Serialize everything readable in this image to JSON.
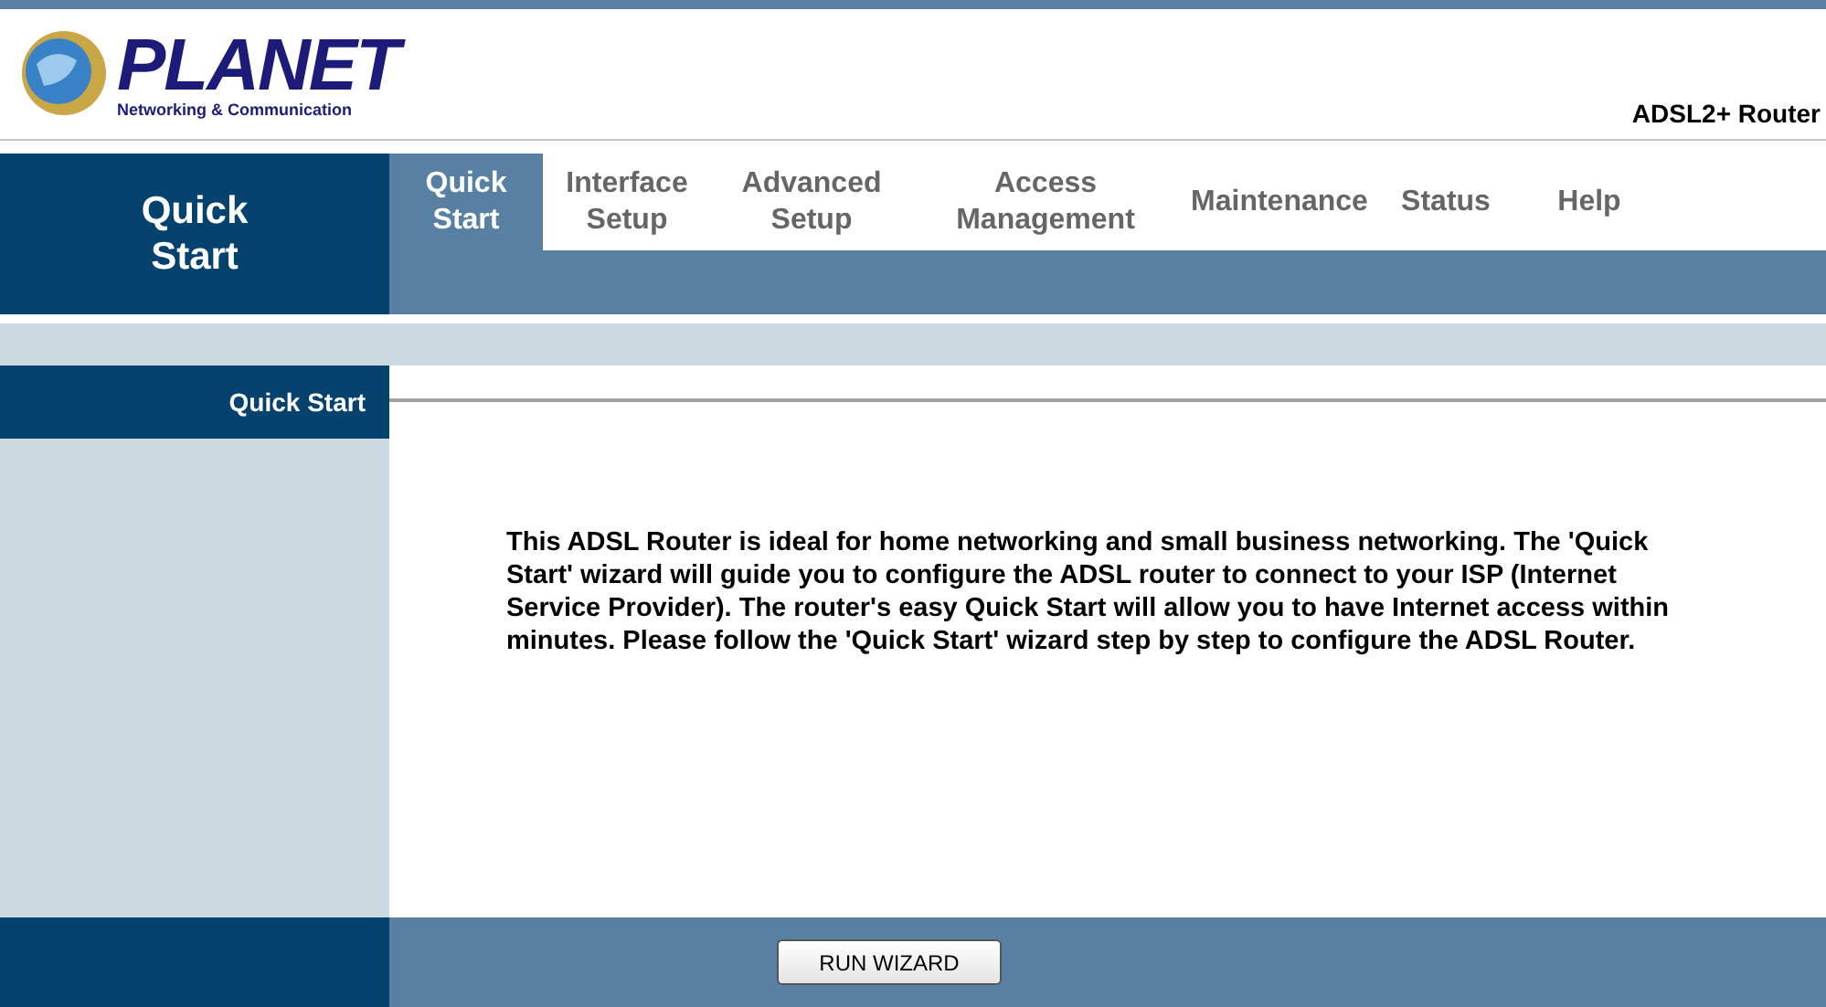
{
  "logo": {
    "name": "PLANET",
    "tagline": "Networking & Communication"
  },
  "product": "ADSL2+ Router",
  "section_title": [
    "Quick",
    "Start"
  ],
  "tabs": [
    {
      "label": [
        "Quick",
        "Start"
      ],
      "selected": true
    },
    {
      "label": [
        "Interface",
        "Setup"
      ],
      "selected": false
    },
    {
      "label": [
        "Advanced",
        "Setup"
      ],
      "selected": false
    },
    {
      "label": [
        "Access",
        "Management"
      ],
      "selected": false
    },
    {
      "label": [
        "Maintenance"
      ],
      "selected": false
    },
    {
      "label": [
        "Status"
      ],
      "selected": false
    },
    {
      "label": [
        "Help"
      ],
      "selected": false
    }
  ],
  "panel": {
    "title": "Quick Start",
    "description": "This ADSL Router is ideal for home networking and small business networking. The 'Quick Start' wizard will guide you to configure the ADSL router to connect to your ISP (Internet Service Provider). The router's easy Quick Start will allow you to have Internet access within minutes. Please follow the 'Quick Start' wizard step by step to configure the ADSL Router."
  },
  "buttons": [
    "RUN WIZARD"
  ]
}
